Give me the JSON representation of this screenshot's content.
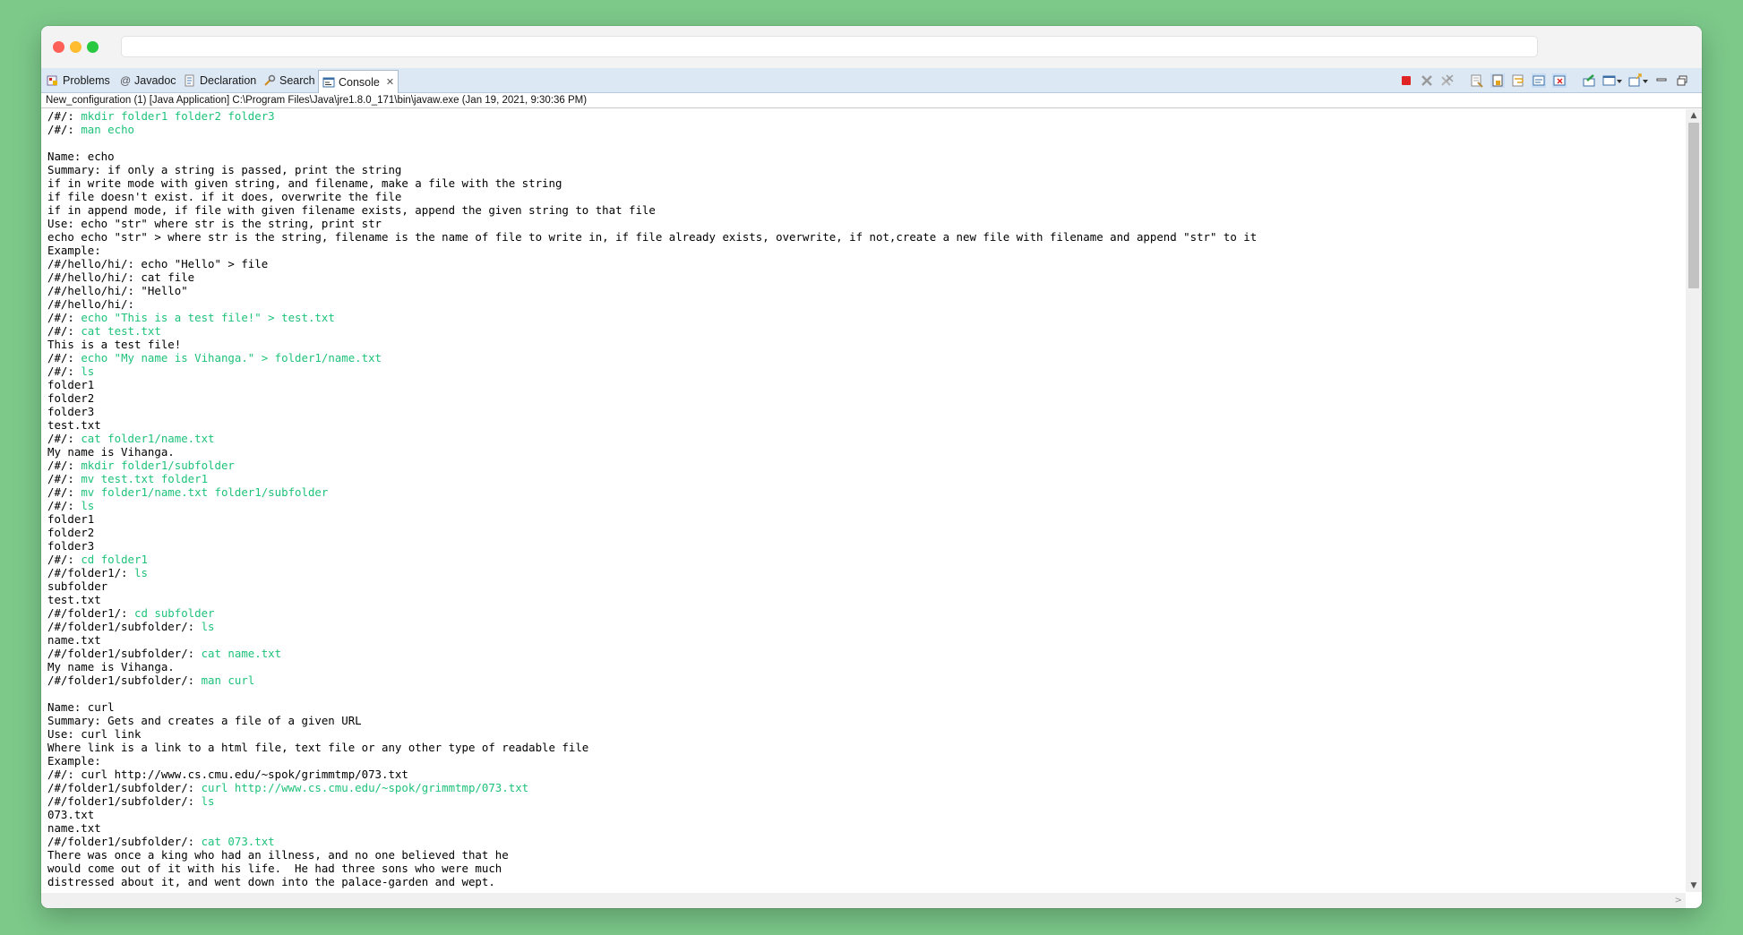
{
  "tabs": [
    {
      "label": "Problems",
      "icon": "problems-icon"
    },
    {
      "label": "Javadoc",
      "icon": "javadoc-icon"
    },
    {
      "label": "Declaration",
      "icon": "declaration-icon"
    },
    {
      "label": "Search",
      "icon": "search-icon"
    },
    {
      "label": "Console",
      "icon": "console-icon",
      "active": true,
      "close": "✕"
    }
  ],
  "info": "New_configuration (1) [Java Application] C:\\Program Files\\Java\\jre1.8.0_171\\bin\\javaw.exe (Jan 19, 2021, 9:30:36 PM)",
  "colors": {
    "command": "#1ec27a",
    "background": "#7cc98a"
  },
  "console_lines": [
    {
      "prompt": "/#/: ",
      "cmd": "mkdir folder1 folder2 folder3"
    },
    {
      "prompt": "/#/: ",
      "cmd": "man echo"
    },
    {
      "text": ""
    },
    {
      "text": "Name: echo"
    },
    {
      "text": "Summary: if only a string is passed, print the string"
    },
    {
      "text": "if in write mode with given string, and filename, make a file with the string"
    },
    {
      "text": "if file doesn't exist. if it does, overwrite the file"
    },
    {
      "text": "if in append mode, if file with given filename exists, append the given string to that file"
    },
    {
      "text": "Use: echo \"str\" where str is the string, print str"
    },
    {
      "text": "echo echo \"str\" > where str is the string, filename is the name of file to write in, if file already exists, overwrite, if not,create a new file with filename and append \"str\" to it"
    },
    {
      "text": "Example:"
    },
    {
      "text": "/#/hello/hi/: echo \"Hello\" > file"
    },
    {
      "text": "/#/hello/hi/: cat file"
    },
    {
      "text": "/#/hello/hi/: \"Hello\""
    },
    {
      "text": "/#/hello/hi/:"
    },
    {
      "prompt": "/#/: ",
      "cmd": "echo \"This is a test file!\" > test.txt"
    },
    {
      "prompt": "/#/: ",
      "cmd": "cat test.txt"
    },
    {
      "text": "This is a test file!"
    },
    {
      "prompt": "/#/: ",
      "cmd": "echo \"My name is Vihanga.\" > folder1/name.txt"
    },
    {
      "prompt": "/#/: ",
      "cmd": "ls"
    },
    {
      "text": "folder1"
    },
    {
      "text": "folder2"
    },
    {
      "text": "folder3"
    },
    {
      "text": "test.txt"
    },
    {
      "prompt": "/#/: ",
      "cmd": "cat folder1/name.txt"
    },
    {
      "text": "My name is Vihanga."
    },
    {
      "prompt": "/#/: ",
      "cmd": "mkdir folder1/subfolder"
    },
    {
      "prompt": "/#/: ",
      "cmd": "mv test.txt folder1"
    },
    {
      "prompt": "/#/: ",
      "cmd": "mv folder1/name.txt folder1/subfolder"
    },
    {
      "prompt": "/#/: ",
      "cmd": "ls"
    },
    {
      "text": "folder1"
    },
    {
      "text": "folder2"
    },
    {
      "text": "folder3"
    },
    {
      "prompt": "/#/: ",
      "cmd": "cd folder1"
    },
    {
      "prompt": "/#/folder1/: ",
      "cmd": "ls"
    },
    {
      "text": "subfolder"
    },
    {
      "text": "test.txt"
    },
    {
      "prompt": "/#/folder1/: ",
      "cmd": "cd subfolder"
    },
    {
      "prompt": "/#/folder1/subfolder/: ",
      "cmd": "ls"
    },
    {
      "text": "name.txt"
    },
    {
      "prompt": "/#/folder1/subfolder/: ",
      "cmd": "cat name.txt"
    },
    {
      "text": "My name is Vihanga."
    },
    {
      "prompt": "/#/folder1/subfolder/: ",
      "cmd": "man curl"
    },
    {
      "text": ""
    },
    {
      "text": "Name: curl"
    },
    {
      "text": "Summary: Gets and creates a file of a given URL"
    },
    {
      "text": "Use: curl link"
    },
    {
      "text": "Where link is a link to a html file, text file or any other type of readable file"
    },
    {
      "text": "Example:"
    },
    {
      "text": "/#/: curl http://www.cs.cmu.edu/~spok/grimmtmp/073.txt"
    },
    {
      "prompt": "/#/folder1/subfolder/: ",
      "cmd": "curl http://www.cs.cmu.edu/~spok/grimmtmp/073.txt"
    },
    {
      "prompt": "/#/folder1/subfolder/: ",
      "cmd": "ls"
    },
    {
      "text": "073.txt"
    },
    {
      "text": "name.txt"
    },
    {
      "prompt": "/#/folder1/subfolder/: ",
      "cmd": "cat 073.txt"
    },
    {
      "text": "There was once a king who had an illness, and no one believed that he"
    },
    {
      "text": "would come out of it with his life.  He had three sons who were much"
    },
    {
      "text": "distressed about it, and went down into the palace-garden and wept."
    }
  ],
  "scroll": {
    "up": "▲",
    "down": "▼",
    "right": ">"
  }
}
